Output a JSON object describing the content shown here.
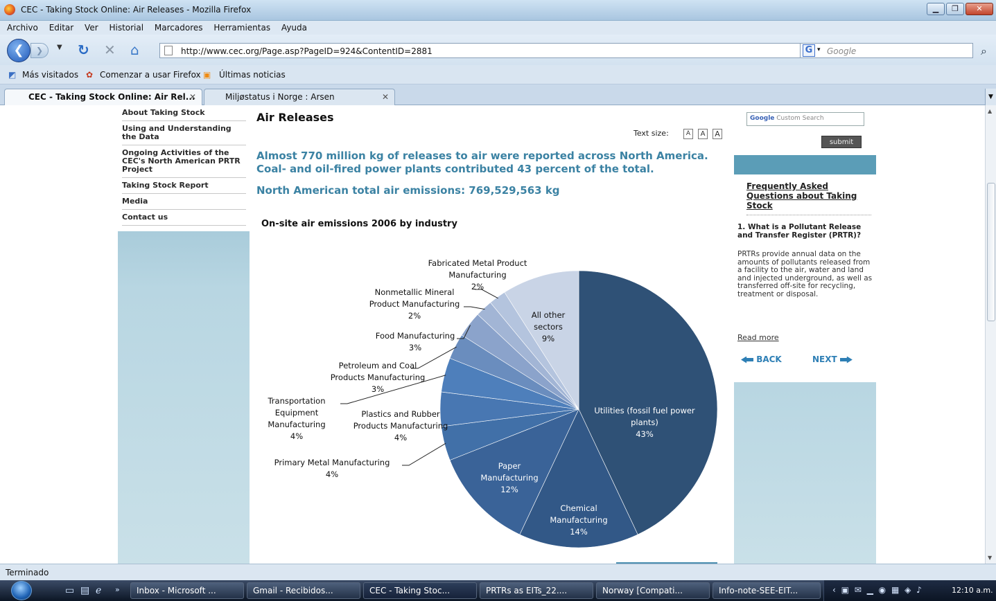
{
  "window": {
    "title": "CEC - Taking Stock Online: Air Releases - Mozilla Firefox",
    "controls": [
      "minimize",
      "maximize",
      "close"
    ]
  },
  "menu": [
    "Archivo",
    "Editar",
    "Ver",
    "Historial",
    "Marcadores",
    "Herramientas",
    "Ayuda"
  ],
  "nav": {
    "url": "http://www.cec.org/Page.asp?PageID=924&ContentID=2881",
    "search_placeholder": "Google"
  },
  "bookmarks": [
    "Más visitados",
    "Comenzar a usar Firefox",
    "Últimas noticias"
  ],
  "tabs": [
    {
      "label": "CEC - Taking Stock Online: Air Rel...",
      "active": true
    },
    {
      "label": "Miljøstatus i Norge : Arsen",
      "active": false
    }
  ],
  "sidebar": {
    "items": [
      "About Taking Stock",
      "Using and Understanding the Data",
      "Ongoing Activities of the CEC's North American PRTR Project",
      "Taking Stock Report",
      "Media",
      "Contact us"
    ]
  },
  "main": {
    "heading": "Air Releases",
    "text_size_label": "Text size:",
    "text_size_buttons": [
      "A",
      "A",
      "A"
    ],
    "lead": "Almost 770 million kg of releases to air were reported across North America. Coal- and oil-fired power plants contributed 43 percent of the total.",
    "total": "North American total air emissions: 769,529,563 kg",
    "chart_title": "On-site air emissions 2006 by industry"
  },
  "chart_data": {
    "type": "pie",
    "title": "On-site air emissions 2006 by industry",
    "unit": "%",
    "slices": [
      {
        "label": "Utilities (fossil fuel power plants)",
        "value": 43,
        "color": "#2f5176"
      },
      {
        "label": "Chemical Manufacturing",
        "value": 14,
        "color": "#325887"
      },
      {
        "label": "Paper Manufacturing",
        "value": 12,
        "color": "#3a6398"
      },
      {
        "label": "Primary Metal Manufacturing",
        "value": 4,
        "color": "#4170a8"
      },
      {
        "label": "Plastics and Rubber Products Manufacturing",
        "value": 4,
        "color": "#4877b2"
      },
      {
        "label": "Transportation Equipment Manufacturing",
        "value": 4,
        "color": "#4e7fbb"
      },
      {
        "label": "Petroleum and Coal Products Manufacturing",
        "value": 3,
        "color": "#6a8dbe"
      },
      {
        "label": "Food Manufacturing",
        "value": 3,
        "color": "#8ba3cb"
      },
      {
        "label": "Nonmetallic Mineral Product Manufacturing",
        "value": 2,
        "color": "#a2b5d5"
      },
      {
        "label": "Fabricated Metal Product Manufacturing",
        "value": 2,
        "color": "#b4c4de"
      },
      {
        "label": "All other sectors",
        "value": 9,
        "color": "#c9d4e6"
      }
    ]
  },
  "pie_labels": {
    "utilities": [
      "Utilities (fossil fuel power",
      "plants)",
      "43%"
    ],
    "chemical": [
      "Chemical",
      "Manufacturing",
      "14%"
    ],
    "paper": [
      "Paper",
      "Manufacturing",
      "12%"
    ],
    "primary": [
      "Primary Metal Manufacturing",
      "4%"
    ],
    "plastics": [
      "Plastics and Rubber",
      "Products Manufacturing",
      "4%"
    ],
    "transport": [
      "Transportation",
      "Equipment",
      "Manufacturing",
      "4%"
    ],
    "petroleum": [
      "Petroleum and Coal",
      "Products Manufacturing",
      "3%"
    ],
    "food": [
      "Food Manufacturing",
      "3%"
    ],
    "nonmetallic": [
      "Nonmetallic Mineral",
      "Product Manufacturing",
      "2%"
    ],
    "fabricated": [
      "Fabricated Metal Product",
      "Manufacturing",
      "2%"
    ],
    "other": [
      "All other",
      "sectors",
      "9%"
    ]
  },
  "right": {
    "search_google": "Google",
    "search_label": "Custom Search",
    "submit": "submit",
    "faq_title": "Frequently Asked Questions about Taking Stock",
    "faq_question": "1. What is a Pollutant Release and Transfer Register (PRTR)?",
    "faq_answer": "PRTRs provide annual data on the amounts of pollutants released from a facility to the air, water and land and injected underground, as well as transferred off-site for recycling, treatment or disposal.",
    "read_more": "Read more",
    "back": "BACK",
    "next": "NEXT"
  },
  "status": "Terminado",
  "taskbar": {
    "tasks": [
      "Inbox - Microsoft ...",
      "Gmail - Recibidos...",
      "CEC - Taking Stoc...",
      "PRTRs as EITs_22....",
      "Norway [Compati...",
      "Info-note-SEE-EIT..."
    ],
    "clock": "12:10 a.m."
  }
}
